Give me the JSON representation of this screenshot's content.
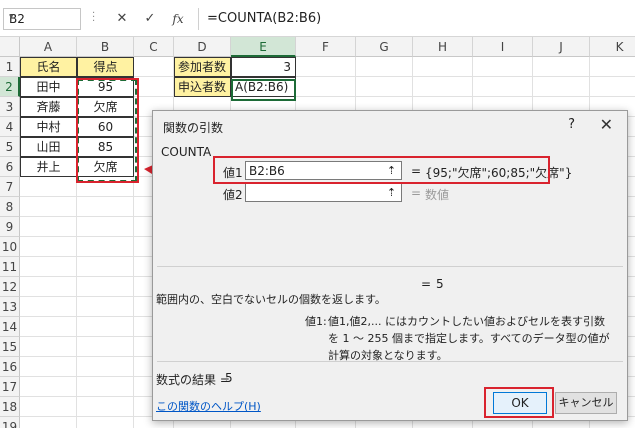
{
  "formula_bar": {
    "name_box": "B2",
    "cancel_icon": "✕",
    "enter_icon": "✓",
    "fx_label": "fx",
    "formula": "=COUNTA(B2:B6)"
  },
  "columns": [
    "A",
    "B",
    "C",
    "D",
    "E",
    "F",
    "G",
    "H",
    "I",
    "J",
    "K"
  ],
  "rows": [
    "1",
    "2",
    "3",
    "4",
    "5",
    "6",
    "7",
    "8",
    "9",
    "10",
    "11",
    "12",
    "13",
    "14",
    "15",
    "16",
    "17",
    "18",
    "19"
  ],
  "cells": {
    "A1": "氏名",
    "B1": "得点",
    "A2": "田中",
    "B2": "95",
    "A3": "斉藤",
    "B3": "欠席",
    "A4": "中村",
    "B4": "60",
    "A5": "山田",
    "B5": "85",
    "A6": "井上",
    "B6": "欠席",
    "D1": "参加者数",
    "E1": "3",
    "D2": "申込者数",
    "E2": "A(B2:B6)"
  },
  "dialog": {
    "title": "関数の引数",
    "help": "?",
    "close_icon": "✕",
    "function_name": "COUNTA",
    "arg1_label": "値1",
    "arg1_value": "B2:B6",
    "arg1_result": "{95;\"欠席\";60;85;\"欠席\"}",
    "arg2_label": "値2",
    "arg2_value": "",
    "arg2_result": "数値",
    "equals": "=",
    "formula_result_preview": "5",
    "function_description": "範囲内の、空白でないセルの個数を返します。",
    "arg_description_label": "値1:",
    "arg_description": "値1,値2,... にはカウントしたい値およびセルを表す引数を 1 〜 255 個まで指定します。すべてのデータ型の値が計算の対象となります。",
    "result_label": "数式の結果 =",
    "result_value": "5",
    "help_link": "この関数のヘルプ(H)",
    "ok_label": "OK",
    "cancel_label": "キャンセル"
  },
  "colors": {
    "accent_green": "#1d6b37",
    "highlight_red": "#d9232e",
    "header_yellow": "#fff2a2"
  }
}
